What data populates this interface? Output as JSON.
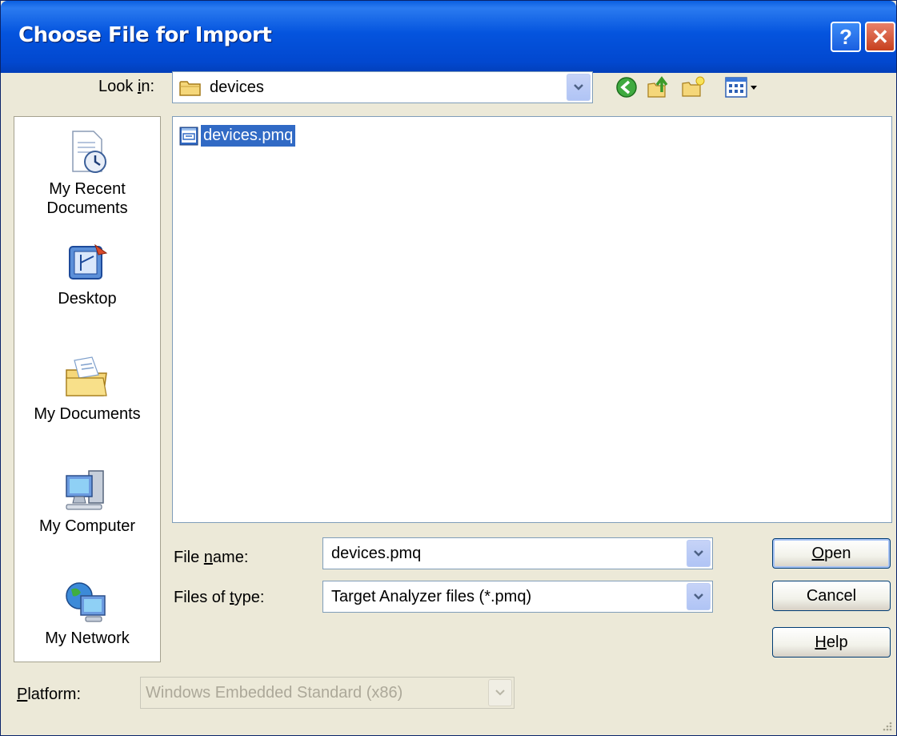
{
  "window": {
    "title": "Choose File for Import",
    "help_glyph": "?",
    "close_glyph": "✕"
  },
  "look_in": {
    "label_pre": "Look ",
    "label_key": "i",
    "label_post": "n:",
    "value": "devices"
  },
  "toolbar": {
    "icons": [
      "back-icon",
      "up-folder-icon",
      "new-folder-icon",
      "views-menu-icon"
    ]
  },
  "places": [
    {
      "label": "My Recent\nDocuments",
      "icon": "recent-documents-icon"
    },
    {
      "label": "Desktop",
      "icon": "desktop-icon"
    },
    {
      "label": "My Documents",
      "icon": "my-documents-icon"
    },
    {
      "label": "My Computer",
      "icon": "my-computer-icon"
    },
    {
      "label": "My Network",
      "icon": "my-network-icon"
    }
  ],
  "files": [
    {
      "name": "devices.pmq",
      "selected": true
    }
  ],
  "file_name": {
    "label_pre": "File ",
    "label_key": "n",
    "label_post": "ame:",
    "value": "devices.pmq"
  },
  "file_type": {
    "label_pre": "Files of ",
    "label_key": "t",
    "label_post": "ype:",
    "value": "Target Analyzer files (*.pmq)"
  },
  "platform": {
    "label_key": "P",
    "label_post": "latform:",
    "value": "Windows Embedded Standard (x86)"
  },
  "buttons": {
    "open": {
      "key": "O",
      "rest": "pen"
    },
    "cancel": {
      "label": "Cancel"
    },
    "help": {
      "key": "H",
      "rest": "elp"
    }
  },
  "colors": {
    "title_bar": "#0454de",
    "selection": "#316ac5",
    "dialog_bg": "#ece9d8"
  }
}
